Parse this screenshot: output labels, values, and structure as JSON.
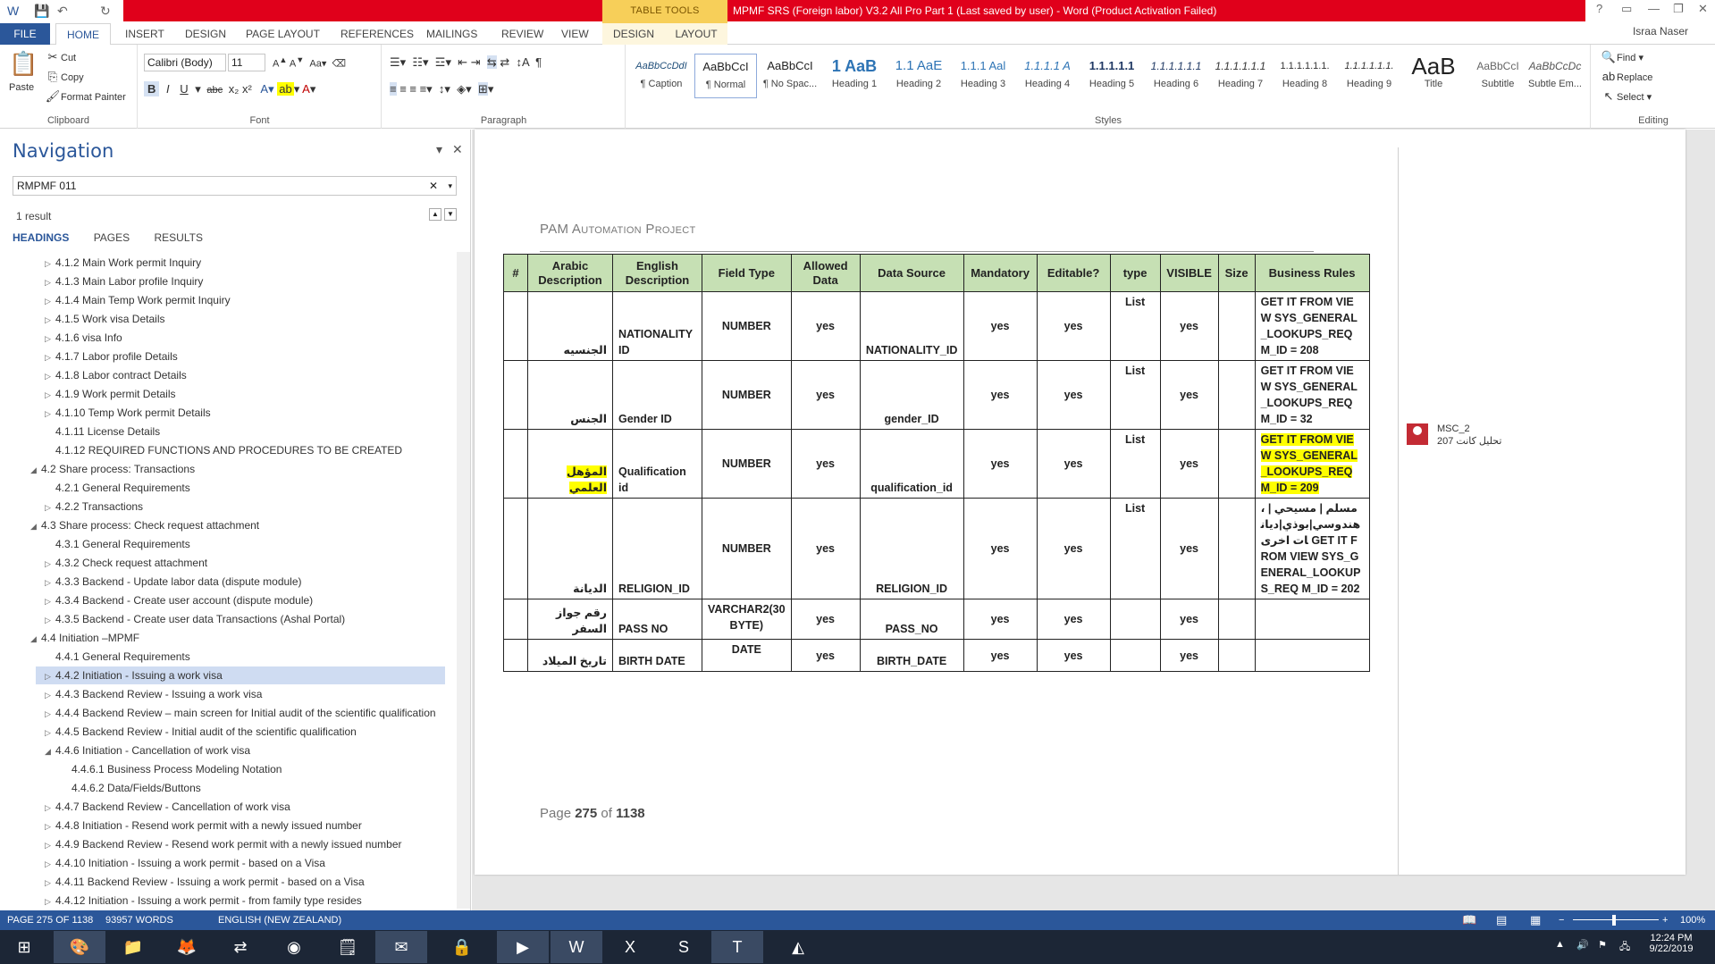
{
  "titlebar": {
    "context_group": "TABLE TOOLS",
    "title": "MPMF SRS (Foreign labor) V3.2 All Pro Part 1 (Last saved by user) -  Word (Product Activation Failed)",
    "user": "Israa Naser",
    "window_controls": [
      "?",
      "▭",
      "—",
      "❐",
      "✕"
    ]
  },
  "ribbon_tabs": [
    "FILE",
    "HOME",
    "INSERT",
    "DESIGN",
    "PAGE LAYOUT",
    "REFERENCES",
    "MAILINGS",
    "REVIEW",
    "VIEW",
    "DESIGN",
    "LAYOUT"
  ],
  "clipboard": {
    "paste": "Paste",
    "cut": "Cut",
    "copy": "Copy",
    "format_painter": "Format Painter",
    "label": "Clipboard"
  },
  "font": {
    "name": "Calibri (Body)",
    "size": "11",
    "label": "Font"
  },
  "paragraph": {
    "label": "Paragraph"
  },
  "styles": {
    "label": "Styles",
    "items": [
      {
        "preview": "AaBbCcDdI",
        "name": "¶ Caption"
      },
      {
        "preview": "AaBbCcI",
        "name": "¶ Normal"
      },
      {
        "preview": "AaBbCcI",
        "name": "¶ No Spac..."
      },
      {
        "preview": "1 AaB",
        "name": "Heading 1"
      },
      {
        "preview": "1.1 AaE",
        "name": "Heading 2"
      },
      {
        "preview": "1.1.1 Aal",
        "name": "Heading 3"
      },
      {
        "preview": "1.1.1.1 A",
        "name": "Heading 4"
      },
      {
        "preview": "1.1.1.1.1",
        "name": "Heading 5"
      },
      {
        "preview": "1.1.1.1.1.1",
        "name": "Heading 6"
      },
      {
        "preview": "1.1.1.1.1.1",
        "name": "Heading 7"
      },
      {
        "preview": "1.1.1.1.1.1.",
        "name": "Heading 8"
      },
      {
        "preview": "1.1.1.1.1.1.",
        "name": "Heading 9"
      },
      {
        "preview": "AaB",
        "name": "Title"
      },
      {
        "preview": "AaBbCcI",
        "name": "Subtitle"
      },
      {
        "preview": "AaBbCcDc",
        "name": "Subtle Em..."
      }
    ]
  },
  "editing": {
    "find": "Find",
    "replace": "Replace",
    "select": "Select",
    "label": "Editing"
  },
  "navigation": {
    "title": "Navigation",
    "search_value": "RMPMF 011",
    "results": "1 result",
    "tabs": [
      "HEADINGS",
      "PAGES",
      "RESULTS"
    ],
    "items": [
      {
        "text": "4.1.2 Main Work permit Inquiry",
        "level": 3,
        "tri": "▷"
      },
      {
        "text": "4.1.3 Main Labor profile Inquiry",
        "level": 3,
        "tri": "▷"
      },
      {
        "text": "4.1.4 Main Temp Work permit Inquiry",
        "level": 3,
        "tri": "▷"
      },
      {
        "text": "4.1.5 Work visa Details",
        "level": 3,
        "tri": "▷"
      },
      {
        "text": "4.1.6 visa Info",
        "level": 3,
        "tri": "▷"
      },
      {
        "text": "4.1.7 Labor profile Details",
        "level": 3,
        "tri": "▷"
      },
      {
        "text": "4.1.8 Labor contract Details",
        "level": 3,
        "tri": "▷"
      },
      {
        "text": "4.1.9 Work permit Details",
        "level": 3,
        "tri": "▷"
      },
      {
        "text": "4.1.10  Temp Work permit Details",
        "level": 3,
        "tri": "▷"
      },
      {
        "text": "4.1.11  License Details",
        "level": 3,
        "tri": ""
      },
      {
        "text": "4.1.12 REQUIRED FUNCTIONS AND PROCEDURES TO BE CREATED",
        "level": 3,
        "tri": ""
      },
      {
        "text": "4.2 Share process:  Transactions",
        "level": 2,
        "tri": "◢"
      },
      {
        "text": "4.2.1 General Requirements",
        "level": 3,
        "tri": ""
      },
      {
        "text": "4.2.2 Transactions",
        "level": 3,
        "tri": "▷"
      },
      {
        "text": "4.3 Share process:  Check request attachment",
        "level": 2,
        "tri": "◢"
      },
      {
        "text": "4.3.1 General Requirements",
        "level": 3,
        "tri": ""
      },
      {
        "text": "4.3.2 Check request attachment",
        "level": 3,
        "tri": "▷"
      },
      {
        "text": "4.3.3 Backend - Update labor data (dispute module)",
        "level": 3,
        "tri": "▷"
      },
      {
        "text": "4.3.4 Backend - Create user account (dispute module)",
        "level": 3,
        "tri": "▷"
      },
      {
        "text": "4.3.5 Backend - Create user data Transactions (Ashal Portal)",
        "level": 3,
        "tri": "▷"
      },
      {
        "text": "4.4 Initiation –MPMF",
        "level": 2,
        "tri": "◢"
      },
      {
        "text": "4.4.1 General Requirements",
        "level": 3,
        "tri": ""
      },
      {
        "text": "4.4.2 Initiation - Issuing a work visa",
        "level": 3,
        "tri": "▷",
        "selected": true
      },
      {
        "text": "4.4.3 Backend Review - Issuing a work visa",
        "level": 3,
        "tri": "▷"
      },
      {
        "text": "4.4.4 Backend Review – main screen for Initial audit of the scientific qualification",
        "level": 3,
        "tri": "▷"
      },
      {
        "text": "4.4.5 Backend Review - Initial audit of the scientific qualification",
        "level": 3,
        "tri": "▷"
      },
      {
        "text": "4.4.6 Initiation - Cancellation of work visa",
        "level": 3,
        "tri": "◢"
      },
      {
        "text": "4.4.6.1 Business Process Modeling Notation",
        "level": 4,
        "tri": ""
      },
      {
        "text": "4.4.6.2 Data/Fields/Buttons",
        "level": 4,
        "tri": ""
      },
      {
        "text": "4.4.7 Backend Review - Cancellation of work visa",
        "level": 3,
        "tri": "▷"
      },
      {
        "text": "4.4.8 Initiation - Resend work permit with a newly issued number",
        "level": 3,
        "tri": "▷"
      },
      {
        "text": "4.4.9 Backend Review - Resend work permit with a newly issued number",
        "level": 3,
        "tri": "▷"
      },
      {
        "text": "4.4.10 Initiation - Issuing a work permit - based on a Visa",
        "level": 3,
        "tri": "▷"
      },
      {
        "text": "4.4.11  Backend Review - Issuing a work permit - based on a Visa",
        "level": 3,
        "tri": "▷"
      },
      {
        "text": "4.4.12 Initiation - Issuing a work permit - from family type resides",
        "level": 3,
        "tri": "▷"
      }
    ]
  },
  "document": {
    "header": "PAM Automation Project",
    "table": {
      "headers": [
        "#",
        "Arabic Description",
        "English Description",
        "Field Type",
        "Allowed Data",
        "Data Source",
        "Mandatory",
        "Editable?",
        "type",
        "VISIBLE",
        "Size",
        "Business Rules"
      ],
      "rows": [
        {
          "num": "",
          "arabic": "الجنسيه",
          "english": "NATIONALITY ID",
          "field_type": "NUMBER",
          "allowed": "yes",
          "source": "NATIONALITY_ID",
          "mandatory": "yes",
          "editable": "yes",
          "type": "List",
          "visible": "yes",
          "size": "",
          "rules": "GET IT FROM VIEW SYS_GENERAL_LOOKUPS_REQ M_ID = 208",
          "highlight": false
        },
        {
          "num": "",
          "arabic": "الجنس",
          "english": "Gender ID",
          "field_type": "NUMBER",
          "allowed": "yes",
          "source": "gender_ID",
          "mandatory": "yes",
          "editable": "yes",
          "type": "List",
          "visible": "yes",
          "size": "",
          "rules": "GET IT FROM VIEW SYS_GENERAL_LOOKUPS_REQ M_ID = 32",
          "highlight": false
        },
        {
          "num": "",
          "arabic": "المؤهل العلمي",
          "english": "Qualification id",
          "field_type": "NUMBER",
          "allowed": "yes",
          "source": "qualification_id",
          "mandatory": "yes",
          "editable": "yes",
          "type": "List",
          "visible": "yes",
          "size": "",
          "rules": "GET IT FROM VIEW SYS_GENERAL_LOOKUPS_REQ M_ID = 209",
          "highlight": true
        },
        {
          "num": "",
          "arabic": "الديانة",
          "english": "RELIGION_ID",
          "field_type": "NUMBER",
          "allowed": "yes",
          "source": "RELIGION_ID",
          "mandatory": "yes",
          "editable": "yes",
          "type": "List",
          "visible": "yes",
          "size": "",
          "rules": "، مسلم | مسيحي | هندوسي|بوذي|ديانات اخرى GET IT FROM VIEW SYS_GENERAL_LOOKUPS_REQ M_ID = 202",
          "highlight": false
        },
        {
          "num": "",
          "arabic": "رقم جواز السفر",
          "english": "PASS NO",
          "field_type": "VARCHAR2(30 BYTE)",
          "allowed": "yes",
          "source": "PASS_NO",
          "mandatory": "yes",
          "editable": "yes",
          "type": "",
          "visible": "yes",
          "size": "",
          "rules": "",
          "highlight": false
        },
        {
          "num": "",
          "arabic": "تاريخ الميلاد",
          "english": "BIRTH DATE",
          "field_type": "DATE",
          "allowed": "yes",
          "source": "BIRTH_DATE",
          "mandatory": "yes",
          "editable": "yes",
          "type": "",
          "visible": "yes",
          "size": "",
          "rules": "",
          "highlight": false
        }
      ]
    },
    "page_prefix": "Page",
    "page_current": "275",
    "page_of": "of",
    "page_total": "1138"
  },
  "comment": {
    "author": "MSC_2",
    "text": "تحليل كانت 207"
  },
  "statusbar": {
    "page": "PAGE 275 OF 1138",
    "words": "93957 WORDS",
    "language": "ENGLISH (NEW ZEALAND)",
    "zoom": "100%"
  },
  "taskbar": {
    "time": "12:24 PM",
    "date": "9/22/2019"
  }
}
